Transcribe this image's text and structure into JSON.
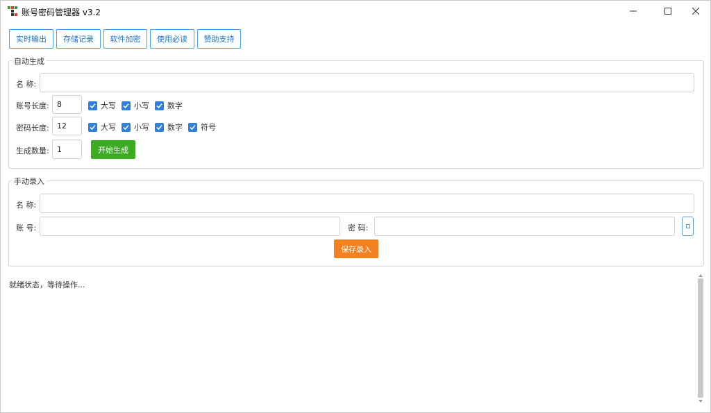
{
  "window": {
    "title": "账号密码管理器 v3.2"
  },
  "toolbar": [
    {
      "label": "实时输出"
    },
    {
      "label": "存储记录"
    },
    {
      "label": "软件加密"
    },
    {
      "label": "使用必读"
    },
    {
      "label": "赞助支持"
    }
  ],
  "auto": {
    "legend": "自动生成",
    "name_label": "名 称:",
    "name_value": "",
    "account_length_label": "账号长度:",
    "account_length_value": "8",
    "account_checks": [
      {
        "label": "大写",
        "checked": true
      },
      {
        "label": "小写",
        "checked": true
      },
      {
        "label": "数字",
        "checked": true
      }
    ],
    "password_length_label": "密码长度:",
    "password_length_value": "12",
    "password_checks": [
      {
        "label": "大写",
        "checked": true
      },
      {
        "label": "小写",
        "checked": true
      },
      {
        "label": "数字",
        "checked": true
      },
      {
        "label": "符号",
        "checked": true
      }
    ],
    "count_label": "生成数量:",
    "count_value": "1",
    "generate_label": "开始生成"
  },
  "manual": {
    "legend": "手动录入",
    "name_label": "名 称:",
    "name_value": "",
    "account_label": "账 号:",
    "account_value": "",
    "password_label": "密 码:",
    "password_value": "",
    "save_label": "保存录入"
  },
  "status": {
    "text": "就绪状态，等待操作..."
  },
  "colors": {
    "accent_blue": "#409eff",
    "checkbox": "#2f7fe0",
    "green": "#3bab22",
    "orange": "#f5801f"
  }
}
